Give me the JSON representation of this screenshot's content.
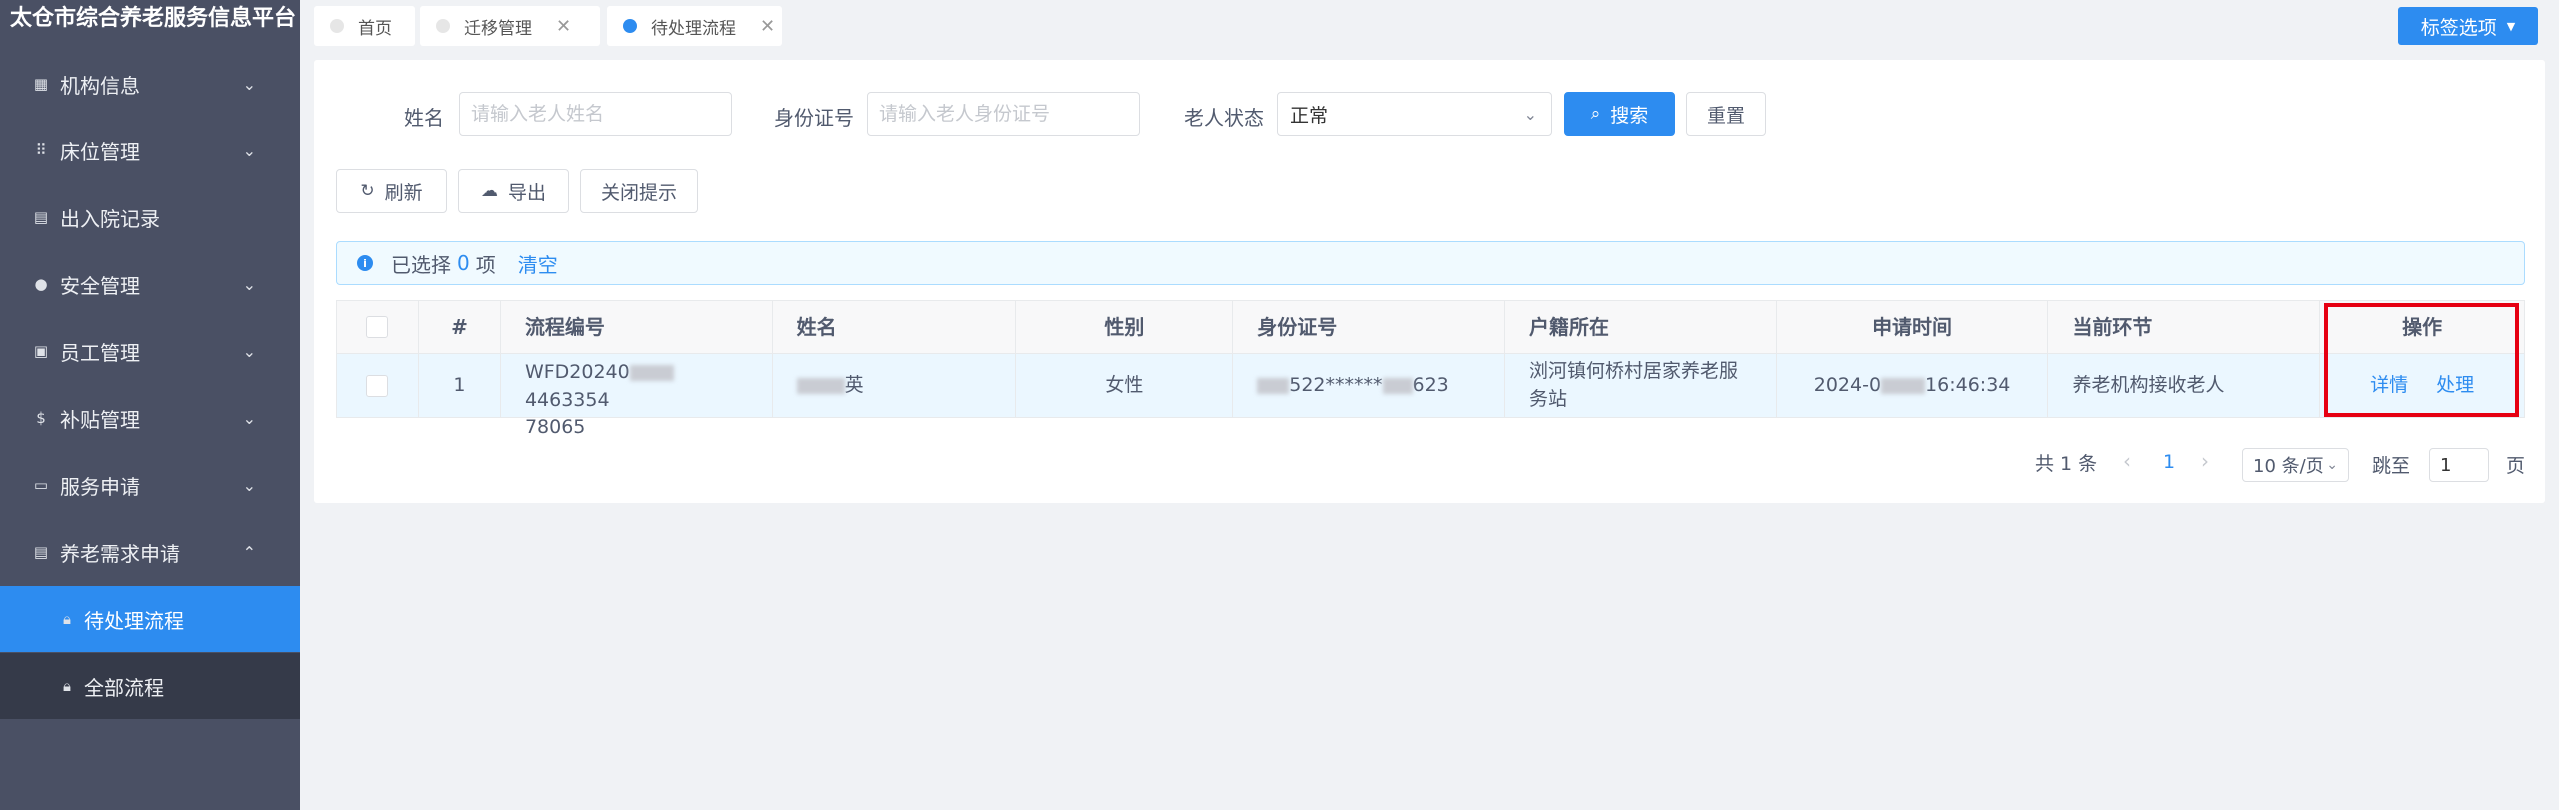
{
  "app": {
    "title": "太仓市综合养老服务信息平台"
  },
  "sidebar": {
    "items": [
      {
        "label": "机构信息",
        "icon": "building-icon",
        "chevron": "⌄"
      },
      {
        "label": "床位管理",
        "icon": "grid-icon",
        "chevron": "⌄"
      },
      {
        "label": "出入院记录",
        "icon": "records-icon",
        "chevron": ""
      },
      {
        "label": "安全管理",
        "icon": "shield-icon",
        "chevron": "⌄"
      },
      {
        "label": "员工管理",
        "icon": "staff-icon",
        "chevron": "⌄"
      },
      {
        "label": "补贴管理",
        "icon": "dollar-icon",
        "chevron": "⌄"
      },
      {
        "label": "服务申请",
        "icon": "calendar-icon",
        "chevron": "⌄"
      },
      {
        "label": "养老需求申请",
        "icon": "doc-icon",
        "chevron": "⌃"
      }
    ],
    "subitems": [
      {
        "label": "待处理流程",
        "icon": "lock-icon"
      },
      {
        "label": "全部流程",
        "icon": "lock-icon"
      }
    ]
  },
  "tabs": [
    {
      "label": "首页",
      "closable": false
    },
    {
      "label": "迁移管理",
      "closable": true
    },
    {
      "label": "待处理流程",
      "closable": true
    }
  ],
  "tab_options": {
    "label": "标签选项"
  },
  "search": {
    "name_label": "姓名",
    "name_placeholder": "请输入老人姓名",
    "id_label": "身份证号",
    "id_placeholder": "请输入老人身份证号",
    "status_label": "老人状态",
    "status_value": "正常",
    "search_button": "搜索",
    "reset_button": "重置"
  },
  "toolbar": {
    "refresh": "刷新",
    "export": "导出",
    "close_tip": "关闭提示"
  },
  "selection": {
    "prefix": "已选择",
    "count": "0",
    "suffix": "项",
    "clear": "清空"
  },
  "table": {
    "headers": [
      "#",
      "流程编号",
      "姓名",
      "性别",
      "身份证号",
      "户籍所在",
      "申请时间",
      "当前环节",
      "操作"
    ],
    "rows": [
      {
        "index": "1",
        "process_no_a": "WFD20240",
        "process_no_b": "4463354",
        "process_no_c": "78065",
        "name": "英",
        "gender": "女性",
        "id_mid": "522******",
        "id_end": "623",
        "residence": "浏河镇何桥村居家养老服务站",
        "apply_time_a": "2024-0",
        "apply_time_b": "16:46:34",
        "stage": "养老机构接收老人",
        "action_detail": "详情",
        "action_process": "处理"
      }
    ]
  },
  "pagination": {
    "total": "共 1 条",
    "prev": "‹",
    "current": "1",
    "next": "›",
    "page_size": "10 条/页",
    "jump_label": "跳至",
    "jump_value": "1",
    "page_suffix": "页"
  },
  "colors": {
    "primary": "#2d8cf0",
    "sidebar_bg": "#4a5064",
    "highlight": "#e60012"
  }
}
